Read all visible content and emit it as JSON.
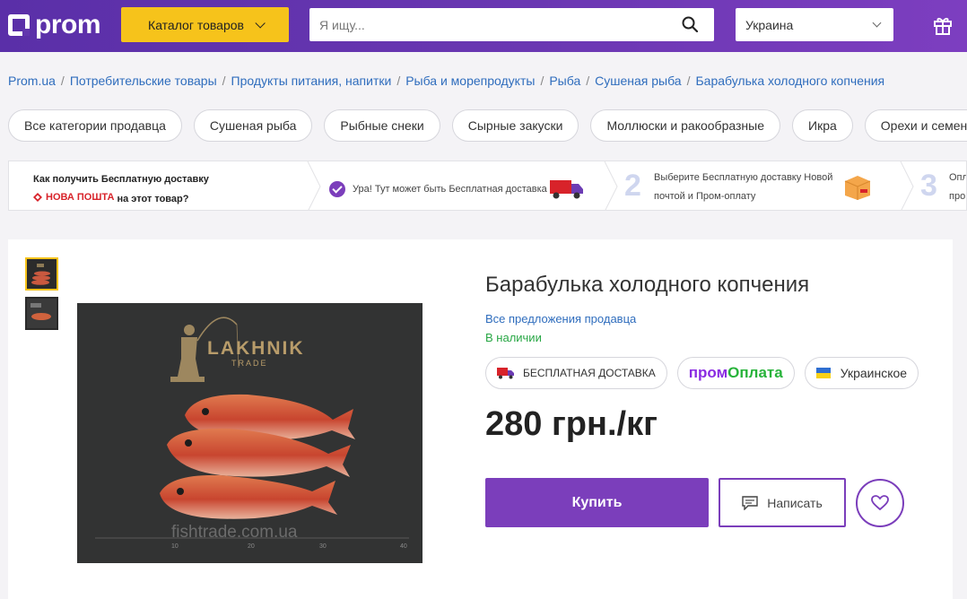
{
  "header": {
    "logo_text": "prom",
    "catalog_label": "Каталог товаров",
    "search_placeholder": "Я ищу...",
    "region": "Украина"
  },
  "breadcrumb": [
    "Prom.ua",
    "Потребительские товары",
    "Продукты питания, напитки",
    "Рыба и морепродукты",
    "Рыба",
    "Сушеная рыба",
    "Барабулька холодного копчения"
  ],
  "categories": [
    "Все категории продавца",
    "Сушеная рыба",
    "Рыбные снеки",
    "Сырные закуски",
    "Моллюски и ракообразные",
    "Икра",
    "Орехи и семена"
  ],
  "delivery_banner": {
    "question_line1": "Как получить Бесплатную доставку",
    "carrier": "НОВА ПОШТА",
    "question_line2": "на этот товар?",
    "step1_text": "Ура! Тут может быть Бесплатная доставка",
    "step2_num": "2",
    "step2_line1": "Выберите Бесплатную доставку Новой",
    "step2_line2": "почтой и Пром-оплату",
    "step3_num": "3",
    "step3_line1": "Опл",
    "step3_line2": "про"
  },
  "product": {
    "title": "Барабулька холодного копчения",
    "seller_link": "Все предложения продавца",
    "stock": "В наличии",
    "badge_free_delivery": "БЕСПЛАТНАЯ ДОСТАВКА",
    "badge_promo_a": "пром",
    "badge_promo_b": "Оплата",
    "badge_origin": "Украинское",
    "price": "280 грн./кг",
    "buy_label": "Купить",
    "write_label": "Написать",
    "image_brand": "LAKHNIK",
    "image_brand_sub": "TRADE",
    "image_watermark": "fishtrade.com.ua",
    "ruler_labels": [
      "10",
      "20",
      "30",
      "40"
    ]
  },
  "colors": {
    "header_purple": "#6236ad",
    "catalog_yellow": "#f6c31b",
    "accent_purple": "#7b3ebb",
    "link_blue": "#2f6dbd",
    "stock_green": "#28a745"
  }
}
